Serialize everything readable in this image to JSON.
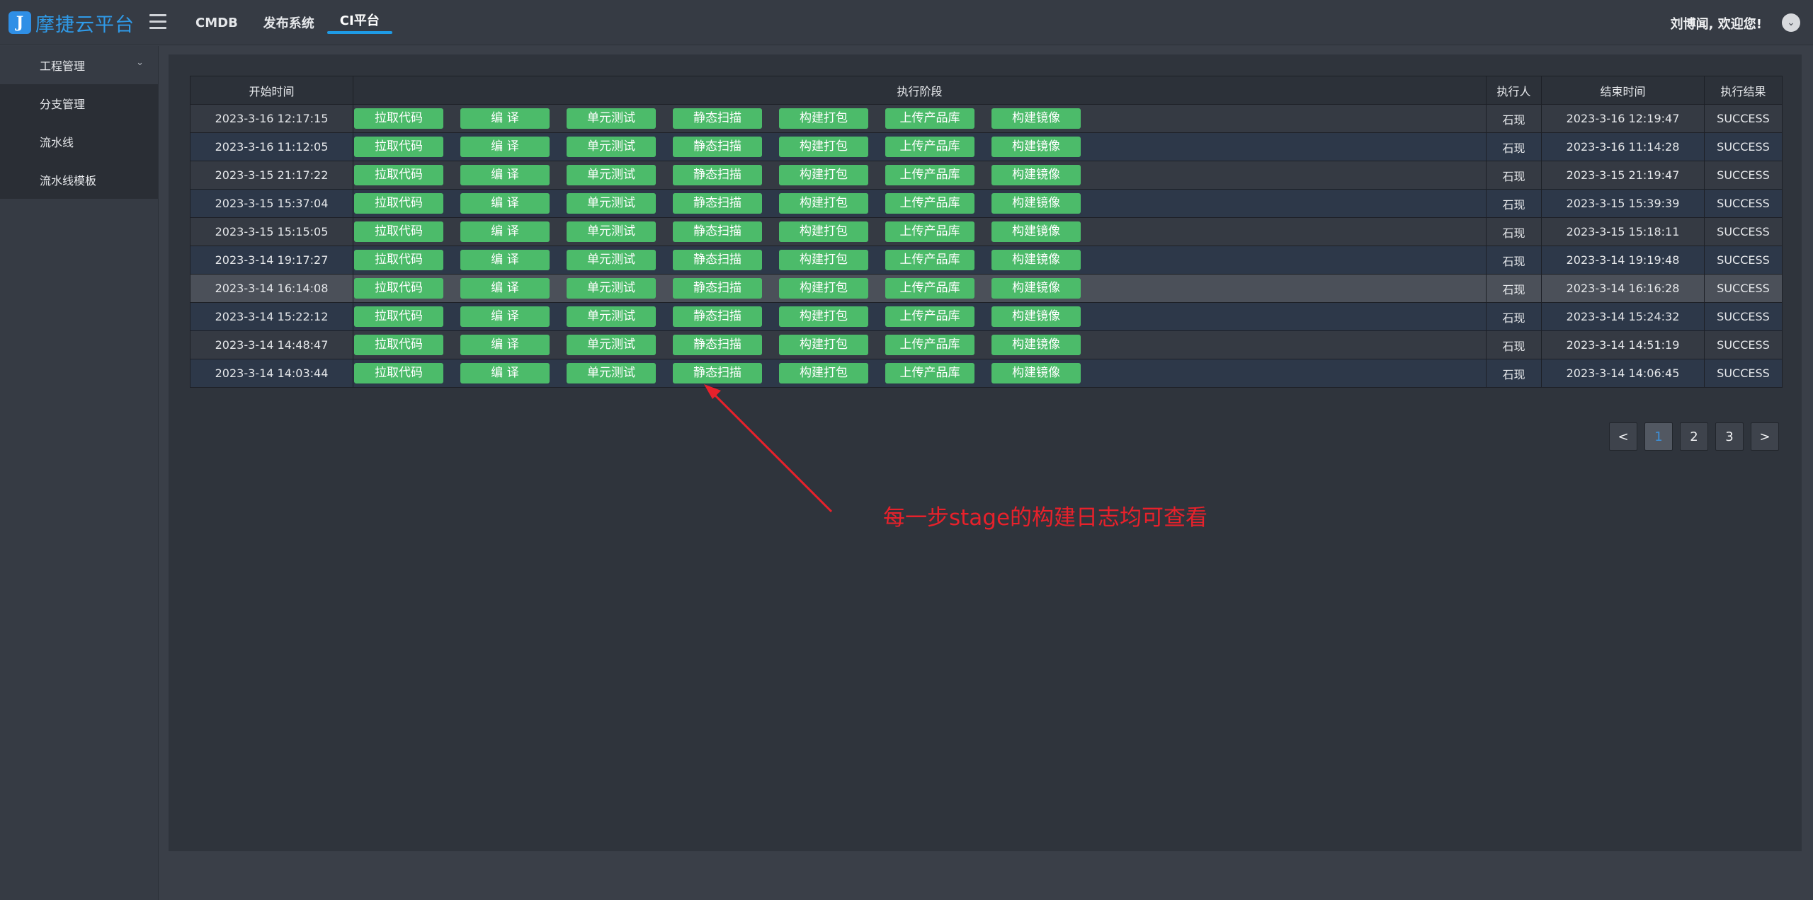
{
  "app": {
    "logo_letter": "J",
    "title": "摩捷云平台",
    "accent_color": "#2f9ae8"
  },
  "top_nav": {
    "items": [
      {
        "label": "CMDB",
        "active": false
      },
      {
        "label": "发布系统",
        "active": false
      },
      {
        "label": "CI平台",
        "active": true
      }
    ],
    "welcome": "刘博闻, 欢迎您!",
    "user_menu_icon": "chevron-down-icon"
  },
  "sidebar": {
    "group_label": "工程管理",
    "group_icon": "chevron-down-icon",
    "items": [
      {
        "label": "分支管理"
      },
      {
        "label": "流水线"
      },
      {
        "label": "流水线模板"
      }
    ]
  },
  "table": {
    "headers": [
      "开始时间",
      "执行阶段",
      "执行人",
      "结束时间",
      "执行结果"
    ],
    "stages": [
      "拉取代码",
      "编 译",
      "单元测试",
      "静态扫描",
      "构建打包",
      "上传产品库",
      "构建镜像"
    ],
    "stage_color": "#4cbb6a",
    "rows": [
      {
        "start": "2023-3-16 12:17:15",
        "executor": "石现",
        "end": "2023-3-16 12:19:47",
        "result": "SUCCESS"
      },
      {
        "start": "2023-3-16 11:12:05",
        "executor": "石现",
        "end": "2023-3-16 11:14:28",
        "result": "SUCCESS"
      },
      {
        "start": "2023-3-15 21:17:22",
        "executor": "石现",
        "end": "2023-3-15 21:19:47",
        "result": "SUCCESS"
      },
      {
        "start": "2023-3-15 15:37:04",
        "executor": "石现",
        "end": "2023-3-15 15:39:39",
        "result": "SUCCESS"
      },
      {
        "start": "2023-3-15 15:15:05",
        "executor": "石现",
        "end": "2023-3-15 15:18:11",
        "result": "SUCCESS"
      },
      {
        "start": "2023-3-14 19:17:27",
        "executor": "石现",
        "end": "2023-3-14 19:19:48",
        "result": "SUCCESS"
      },
      {
        "start": "2023-3-14 16:14:08",
        "executor": "石现",
        "end": "2023-3-14 16:16:28",
        "result": "SUCCESS",
        "highlighted": true
      },
      {
        "start": "2023-3-14 15:22:12",
        "executor": "石现",
        "end": "2023-3-14 15:24:32",
        "result": "SUCCESS"
      },
      {
        "start": "2023-3-14 14:48:47",
        "executor": "石现",
        "end": "2023-3-14 14:51:19",
        "result": "SUCCESS"
      },
      {
        "start": "2023-3-14 14:03:44",
        "executor": "石现",
        "end": "2023-3-14 14:06:45",
        "result": "SUCCESS"
      }
    ]
  },
  "pagination": {
    "prev_label": "<",
    "next_label": ">",
    "pages": [
      "1",
      "2",
      "3"
    ],
    "current": "1"
  },
  "annotation": {
    "text": "每一步stage的构建日志均可查看",
    "color": "#e8212b"
  }
}
